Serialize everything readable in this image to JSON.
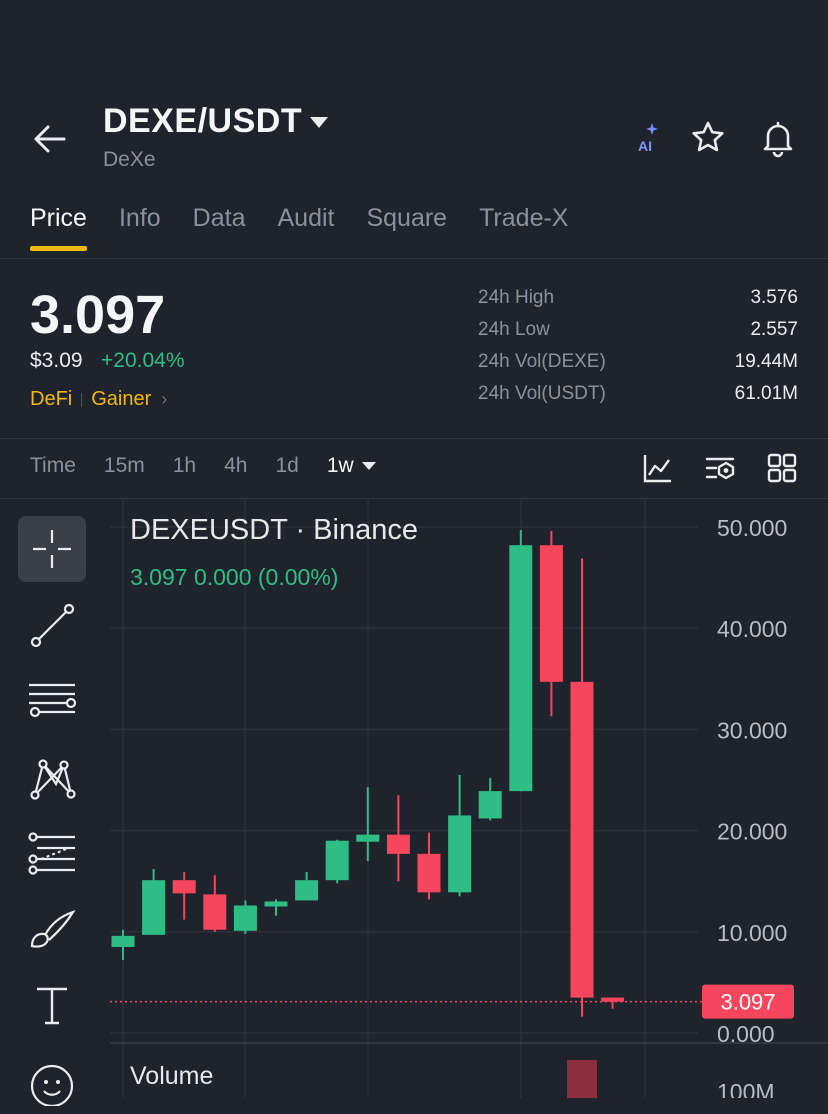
{
  "header": {
    "pair": "DEXE/USDT",
    "name": "DeXe",
    "ai_label": "AI"
  },
  "tabs": [
    {
      "label": "Price",
      "active": true
    },
    {
      "label": "Info"
    },
    {
      "label": "Data"
    },
    {
      "label": "Audit"
    },
    {
      "label": "Square"
    },
    {
      "label": "Trade-X"
    }
  ],
  "price": {
    "last": "3.097",
    "usd": "$3.09",
    "change": "+20.04%",
    "tags": [
      "DeFi",
      "Gainer"
    ]
  },
  "stats": [
    {
      "label": "24h High",
      "value": "3.576"
    },
    {
      "label": "24h Low",
      "value": "2.557"
    },
    {
      "label": "24h Vol(DEXE)",
      "value": "19.44M"
    },
    {
      "label": "24h Vol(USDT)",
      "value": "61.01M"
    }
  ],
  "intervals": {
    "label": "Time",
    "options": [
      "15m",
      "1h",
      "4h",
      "1d"
    ],
    "selected": "1w"
  },
  "chart": {
    "title": "DEXEUSDT · Binance",
    "ohlc": "3.097  0.000 (0.00%)",
    "volume_label": "Volume",
    "current_price_tag": "3.097",
    "volume_axis_label": "100M",
    "colors": {
      "up": "#2ebd85",
      "down": "#f6465d",
      "background": "#1f232b"
    }
  },
  "chart_data": {
    "type": "candlestick",
    "y_ticks": [
      "50.000",
      "40.000",
      "30.000",
      "20.000",
      "10.000",
      "0.000"
    ],
    "ylim": [
      0,
      50
    ],
    "last_price": 3.097,
    "candles": [
      {
        "o": 8.5,
        "h": 10.2,
        "l": 7.2,
        "c": 9.6
      },
      {
        "o": 9.7,
        "h": 16.2,
        "l": 9.7,
        "c": 15.1
      },
      {
        "o": 15.1,
        "h": 15.9,
        "l": 11.2,
        "c": 13.8
      },
      {
        "o": 13.7,
        "h": 15.6,
        "l": 10.0,
        "c": 10.2
      },
      {
        "o": 10.1,
        "h": 13.1,
        "l": 9.8,
        "c": 12.6
      },
      {
        "o": 12.5,
        "h": 13.2,
        "l": 11.6,
        "c": 13.0
      },
      {
        "o": 13.1,
        "h": 15.9,
        "l": 13.1,
        "c": 15.1
      },
      {
        "o": 15.1,
        "h": 19.1,
        "l": 14.8,
        "c": 19.0
      },
      {
        "o": 18.9,
        "h": 24.3,
        "l": 17.0,
        "c": 19.6
      },
      {
        "o": 19.6,
        "h": 23.5,
        "l": 15.0,
        "c": 17.7
      },
      {
        "o": 17.7,
        "h": 19.8,
        "l": 13.2,
        "c": 13.9
      },
      {
        "o": 13.9,
        "h": 25.5,
        "l": 13.5,
        "c": 21.5
      },
      {
        "o": 21.2,
        "h": 25.2,
        "l": 21.0,
        "c": 23.9
      },
      {
        "o": 23.9,
        "h": 49.7,
        "l": 23.9,
        "c": 48.2
      },
      {
        "o": 48.2,
        "h": 49.6,
        "l": 31.3,
        "c": 34.7
      },
      {
        "o": 34.7,
        "h": 46.9,
        "l": 1.6,
        "c": 3.5
      },
      {
        "o": 3.5,
        "h": 3.5,
        "l": 2.4,
        "c": 3.097
      }
    ],
    "volume_bars": [
      {
        "index": 15,
        "direction": "down"
      }
    ]
  }
}
